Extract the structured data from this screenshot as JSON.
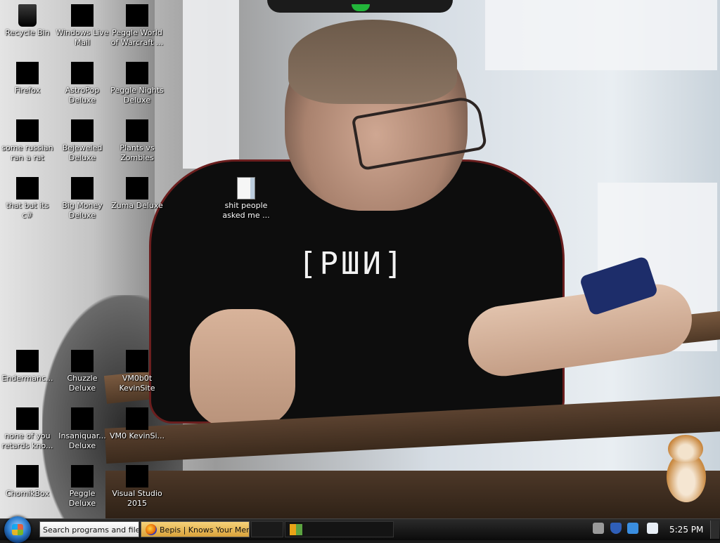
{
  "wallpaper": {
    "shirt_text": "[РШИ]"
  },
  "desktop_icons": [
    {
      "label": "Recycle Bin",
      "icon": "recycle-bin-icon"
    },
    {
      "label": "Windows Live Mail",
      "icon": "app-icon"
    },
    {
      "label": "Peggle World of Warcraft ...",
      "icon": "app-icon"
    },
    {
      "label": "Firefox",
      "icon": "app-icon"
    },
    {
      "label": "AstroPop Deluxe",
      "icon": "app-icon"
    },
    {
      "label": "Peggle Nights Deluxe",
      "icon": "app-icon"
    },
    {
      "label": "some russian ran a rat",
      "icon": "app-icon"
    },
    {
      "label": "Bejeweled Deluxe",
      "icon": "app-icon"
    },
    {
      "label": "Plants vs Zombies",
      "icon": "app-icon"
    },
    {
      "label": "that but its c#",
      "icon": "app-icon"
    },
    {
      "label": "Big Money Deluxe",
      "icon": "app-icon"
    },
    {
      "label": "Zuma Deluxe",
      "icon": "app-icon"
    },
    {
      "label": "shit people asked me ...",
      "icon": "file-icon"
    },
    {
      "label": "Endermanc...",
      "icon": "app-icon"
    },
    {
      "label": "Chuzzle Deluxe",
      "icon": "app-icon"
    },
    {
      "label": "VM0b0t KevinSite",
      "icon": "app-icon"
    },
    {
      "label": "none of you retards kno...",
      "icon": "app-icon"
    },
    {
      "label": "Insaniquar... Deluxe",
      "icon": "app-icon"
    },
    {
      "label": "VM0 KevinSi...",
      "icon": "app-icon"
    },
    {
      "label": "ChomikBox",
      "icon": "app-icon"
    },
    {
      "label": "Peggle Deluxe",
      "icon": "app-icon"
    },
    {
      "label": "Visual Studio 2015",
      "icon": "app-icon"
    }
  ],
  "taskbar": {
    "search_button_label": "Search programs and files",
    "firefox_button_label": "Bepis | Knows Your Mem",
    "clock": "5:25 PM"
  },
  "colors": {
    "taskbar": "#111111",
    "notch_arrow": "#22b53a"
  }
}
